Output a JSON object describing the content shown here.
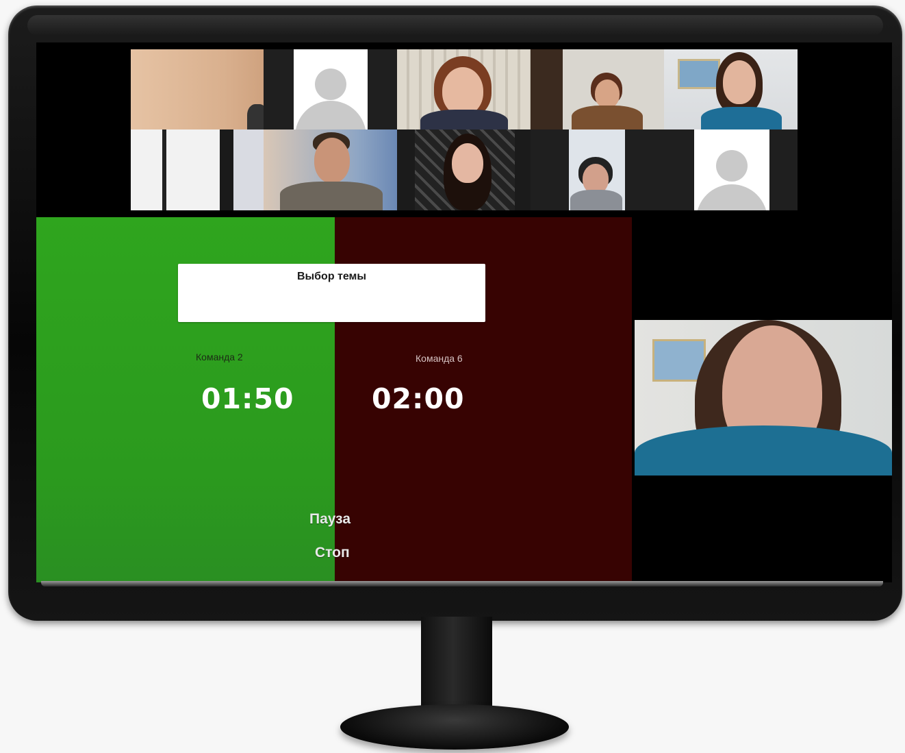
{
  "meeting": {
    "participants": [
      {
        "type": "video",
        "desc": "wall"
      },
      {
        "type": "avatar"
      },
      {
        "type": "video"
      },
      {
        "type": "video"
      },
      {
        "type": "video"
      },
      {
        "type": "video"
      },
      {
        "type": "video"
      },
      {
        "type": "video"
      },
      {
        "type": "video"
      },
      {
        "type": "avatar"
      }
    ]
  },
  "game": {
    "topic_title": "Выбор темы",
    "left_team": {
      "label": "Команда 2",
      "timer": "01:50",
      "color": "#2fa51e"
    },
    "right_team": {
      "label": "Команда 6",
      "timer": "02:00",
      "color": "#370302"
    },
    "controls": {
      "pause_label": "Пауза",
      "stop_label": "Стоп"
    }
  },
  "icons": [
    "default-avatar-icon"
  ]
}
